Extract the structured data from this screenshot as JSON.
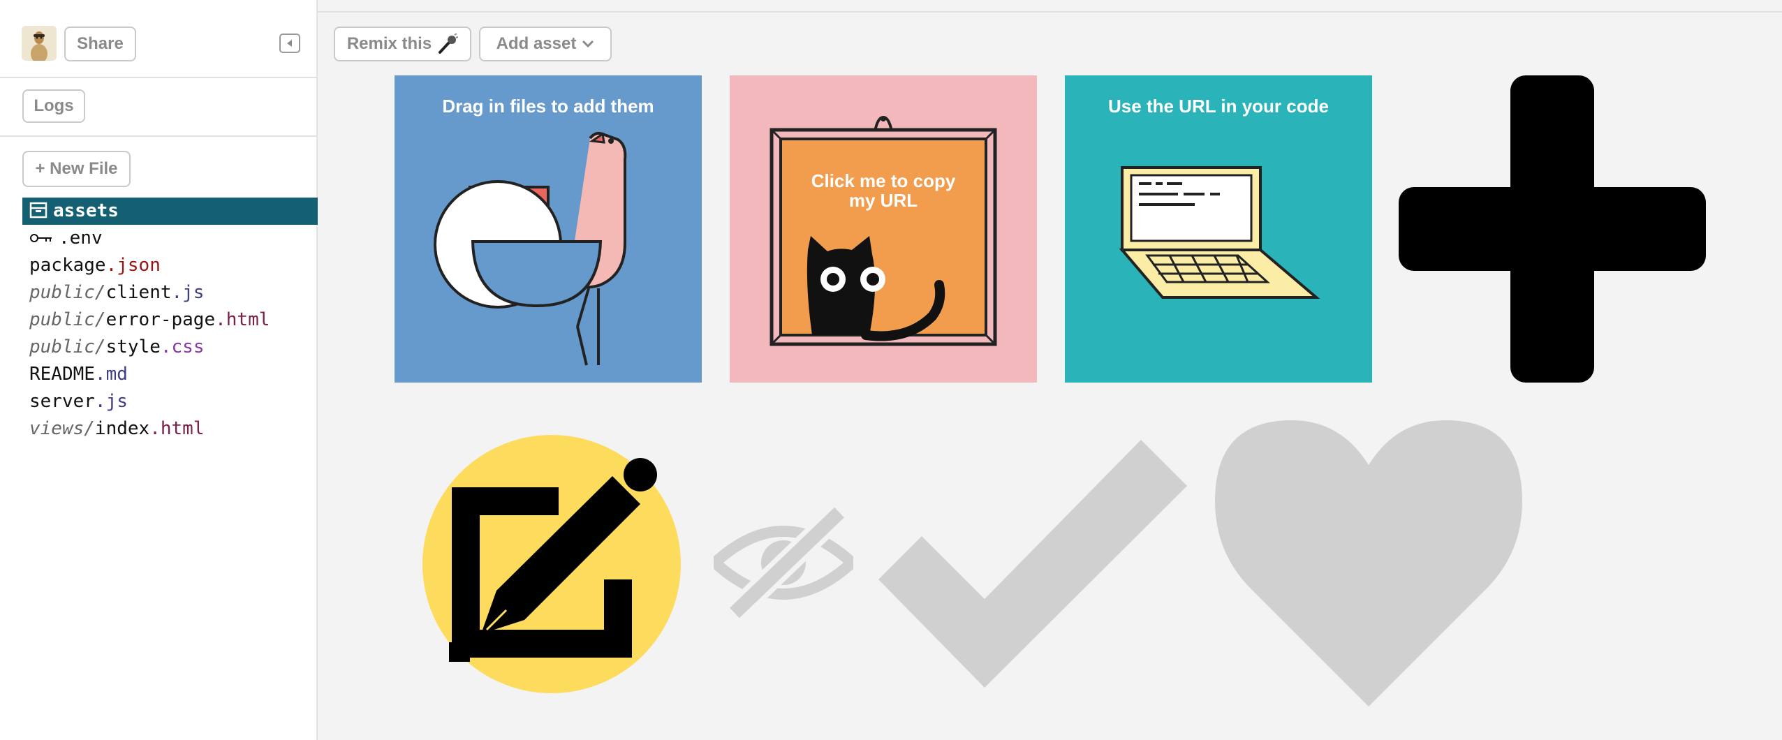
{
  "toolbar": {
    "share_label": "Share",
    "logs_label": "Logs",
    "new_file_label": "+ New File",
    "remix_label": "Remix this",
    "remix_icon": "microphone-icon",
    "add_asset_label": "Add asset",
    "add_asset_icon": "chevron-down-icon",
    "collapse_icon": "collapse-sidebar-icon"
  },
  "files": [
    {
      "dir": "",
      "name": "assets",
      "ext": "",
      "icon": "box-icon",
      "selected": true
    },
    {
      "dir": "",
      "name": ".env",
      "ext": "",
      "icon": "key-icon",
      "selected": false
    },
    {
      "dir": "",
      "name": "package",
      "ext": ".json",
      "selected": false
    },
    {
      "dir": "public/",
      "name": "client",
      "ext": ".js",
      "selected": false
    },
    {
      "dir": "public/",
      "name": "error-page",
      "ext": ".html",
      "selected": false
    },
    {
      "dir": "public/",
      "name": "style",
      "ext": ".css",
      "selected": false
    },
    {
      "dir": "",
      "name": "README",
      "ext": ".md",
      "selected": false
    },
    {
      "dir": "",
      "name": "server",
      "ext": ".js",
      "selected": false
    },
    {
      "dir": "views/",
      "name": "index",
      "ext": ".html",
      "selected": false
    }
  ],
  "assets": {
    "tile_drag": {
      "caption": "Drag in files to add them",
      "bg": "#6699cc"
    },
    "tile_copy": {
      "caption_line1": "Click me to copy",
      "caption_line2": "my URL",
      "bg": "#f2b8bb",
      "frame_bg": "#f29d4e"
    },
    "tile_url": {
      "caption": "Use the URL in your code",
      "bg": "#2ab3b8"
    },
    "icons": [
      "plus-icon",
      "edit-icon",
      "eye-slash-icon",
      "checkmark-icon",
      "heart-icon"
    ]
  },
  "colors": {
    "selected_file_bg": "#145f72",
    "edit_icon_circle": "#fddb5d",
    "muted_icon": "#d0d0d0",
    "button_border": "#c9c9c9"
  }
}
